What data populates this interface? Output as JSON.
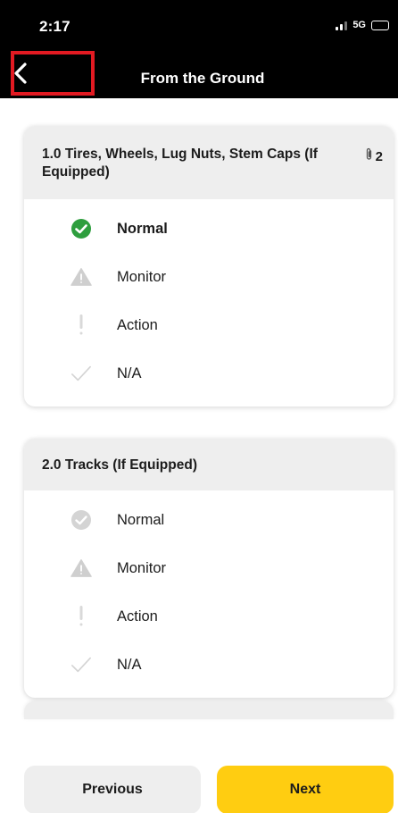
{
  "status_bar": {
    "time": "2:17",
    "network": "5G"
  },
  "nav": {
    "title": "From the Ground"
  },
  "sections": [
    {
      "title": "1.0 Tires, Wheels, Lug Nuts, Stem Caps (If Equipped)",
      "attachment_count": "2",
      "options": [
        {
          "label": "Normal",
          "icon": "check-circle-icon",
          "selected": true
        },
        {
          "label": "Monitor",
          "icon": "warning-triangle-icon",
          "selected": false
        },
        {
          "label": "Action",
          "icon": "exclamation-icon",
          "selected": false
        },
        {
          "label": "N/A",
          "icon": "checkmark-icon",
          "selected": false
        }
      ]
    },
    {
      "title": "2.0 Tracks (If Equipped)",
      "options": [
        {
          "label": "Normal",
          "icon": "check-circle-icon",
          "selected": false
        },
        {
          "label": "Monitor",
          "icon": "warning-triangle-icon",
          "selected": false
        },
        {
          "label": "Action",
          "icon": "exclamation-icon",
          "selected": false
        },
        {
          "label": "N/A",
          "icon": "checkmark-icon",
          "selected": false
        }
      ]
    }
  ],
  "footer": {
    "previous_label": "Previous",
    "next_label": "Next"
  },
  "colors": {
    "topbar": "#000000",
    "highlight_box": "#e21a22",
    "selected_green": "#2e9e3e",
    "inactive_icon": "#cfcfcf",
    "next_button": "#ffcd11",
    "card_header": "#eeeeee"
  }
}
